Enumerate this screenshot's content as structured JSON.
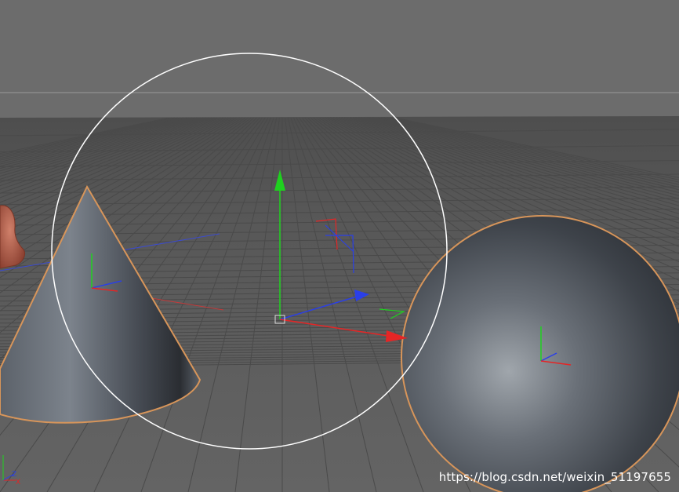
{
  "viewport": {
    "background_color": "#6c6c6c",
    "floor_color": "#5a5a5a",
    "grid_color": "#4a4a4a",
    "horizon_color": "#9a9a9a"
  },
  "objects": [
    {
      "name": "bust",
      "material_color": "#b0614c",
      "selected": false
    },
    {
      "name": "cone",
      "material_color": "#4a5058",
      "selected": true,
      "outline_color": "#d7955a"
    },
    {
      "name": "sphere",
      "material_color": "#50565e",
      "selected": true,
      "outline_color": "#d7955a"
    },
    {
      "name": "null-object",
      "helper": "circle",
      "selected": true
    }
  ],
  "axis_colors": {
    "x": "#e52525",
    "y": "#1fd11f",
    "z": "#2a3fe8"
  },
  "gizmo": {
    "mode": "move"
  },
  "world_axis_labels": [
    "Z",
    "X"
  ],
  "watermark": "https://blog.csdn.net/weixin_51197655"
}
